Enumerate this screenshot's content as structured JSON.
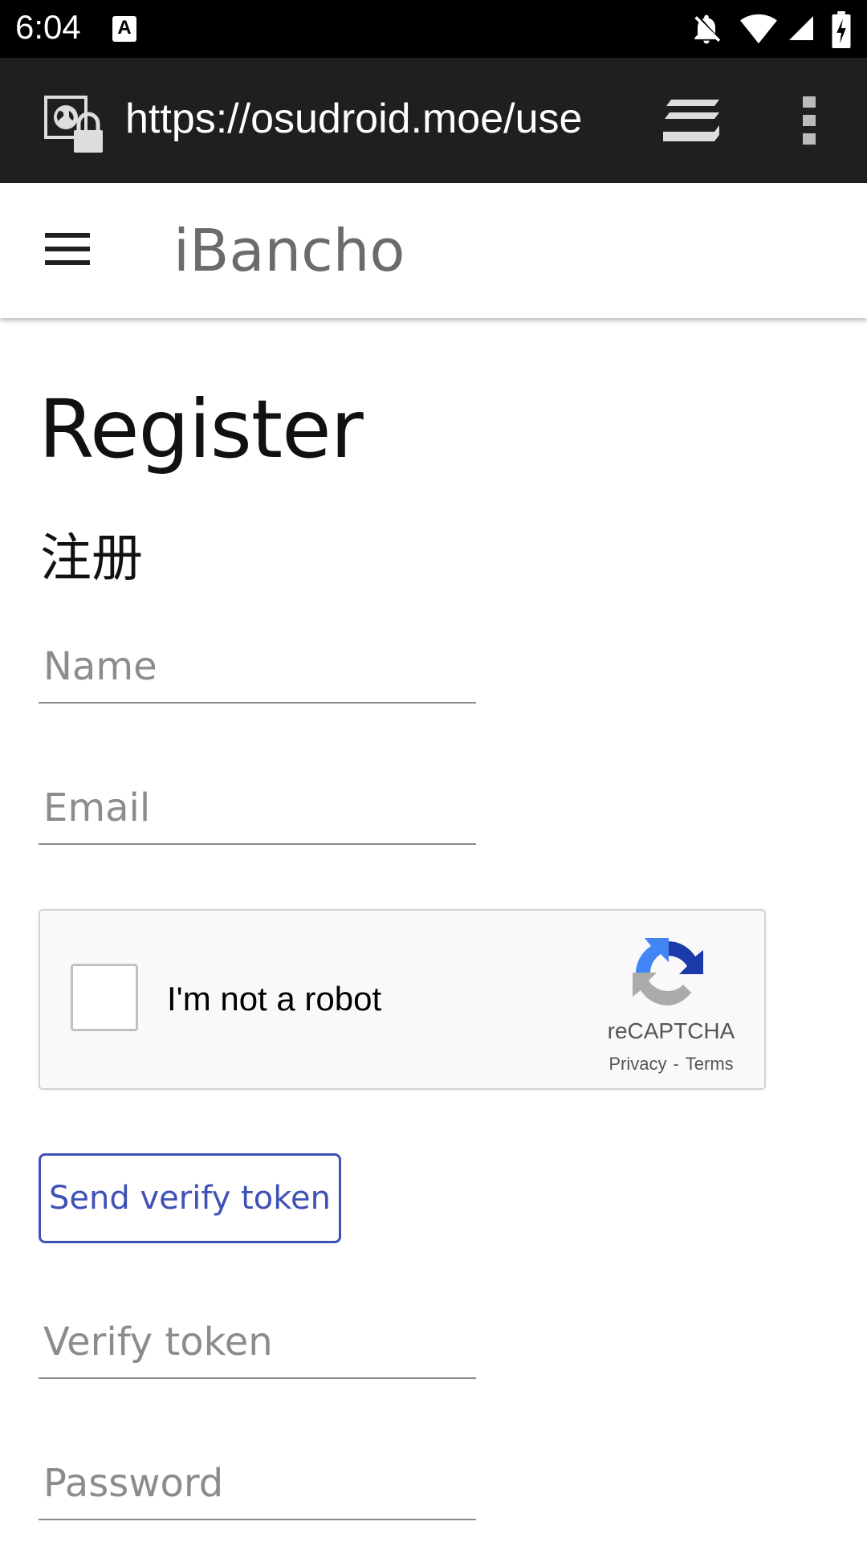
{
  "status_bar": {
    "time": "6:04",
    "notification_icon_letter": "A",
    "icons": [
      "notifications-off-icon",
      "wifi-icon",
      "signal-icon",
      "battery-charging-icon"
    ]
  },
  "browser": {
    "url": "https://osudroid.moe/use",
    "icons": [
      "site-info-lock-icon",
      "tabs-icon",
      "more-vert-icon"
    ]
  },
  "app_header": {
    "title": "iBancho",
    "menu_icon": "hamburger-icon"
  },
  "page": {
    "title": "Register",
    "subtitle": "注册"
  },
  "form": {
    "name_placeholder": "Name",
    "email_placeholder": "Email",
    "verify_token_placeholder": "Verify token",
    "password_placeholder": "Password",
    "send_button_label": "Send verify token"
  },
  "recaptcha": {
    "checkbox_label": "I'm not a robot",
    "brand": "reCAPTCHA",
    "privacy_link": "Privacy",
    "separator": "-",
    "terms_link": "Terms"
  },
  "colors": {
    "accent": "#3f51b5",
    "browser_bar": "#1f1f1f",
    "title_gray": "#6b6b6b"
  }
}
